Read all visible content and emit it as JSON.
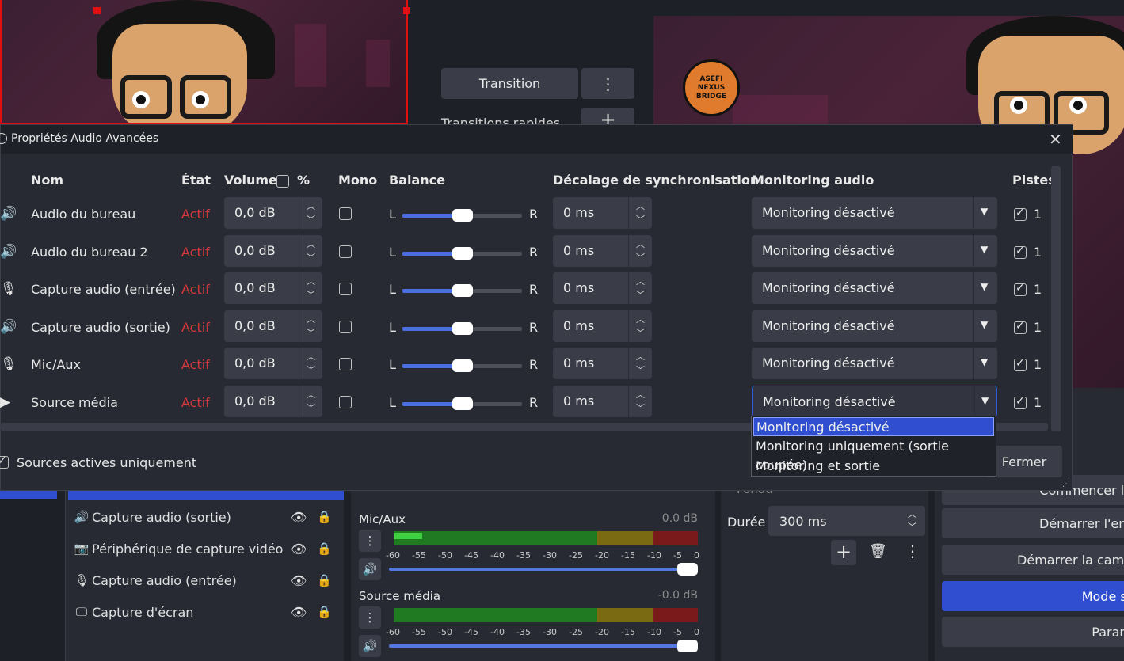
{
  "background": {
    "transition_button": "Transition",
    "quick_transitions_label": "Transitions rapides",
    "logo_text": "ASEFI NEXUS BRIDGE",
    "sources": [
      {
        "icon": "speaker-icon",
        "glyph": "🔊",
        "label": "Capture audio (sortie)"
      },
      {
        "icon": "camera-icon",
        "glyph": "📷",
        "label": "Périphérique de capture vidéo"
      },
      {
        "icon": "microphone-icon",
        "glyph": "🎙",
        "label": "Capture audio (entrée)"
      },
      {
        "icon": "monitor-icon",
        "glyph": "🖵",
        "label": "Capture d'écran"
      }
    ],
    "mixer": [
      {
        "name": "Mic/Aux",
        "db": "0.0 dB"
      },
      {
        "name": "Source média",
        "db": "-0.0 dB"
      }
    ],
    "meter_scale": [
      "-60",
      "-55",
      "-50",
      "-45",
      "-40",
      "-35",
      "-30",
      "-25",
      "-20",
      "-15",
      "-10",
      "-5",
      "0"
    ],
    "transition_panel": {
      "fade_label": "Fondu",
      "duration_label": "Durée",
      "duration_value": "300 ms"
    },
    "controls": [
      {
        "label": "Commencer le",
        "style": "dark"
      },
      {
        "label": "Démarrer l'enr",
        "style": "dark"
      },
      {
        "label": "Démarrer la camé",
        "style": "dark"
      },
      {
        "label": "Mode st",
        "style": "blue"
      },
      {
        "label": "Param",
        "style": "dark"
      }
    ]
  },
  "dialog": {
    "title": "Propriétés Audio Avancées",
    "headers": {
      "name": "Nom",
      "state": "État",
      "volume": "Volume",
      "percent": "%",
      "mono": "Mono",
      "balance": "Balance",
      "sync_offset": "Décalage de synchronisation",
      "monitoring": "Monitoring audio",
      "tracks": "Pistes"
    },
    "balance_L": "L",
    "balance_R": "R",
    "rows": [
      {
        "icon": "speaker-icon",
        "glyph": "🔊",
        "name": "Audio du bureau",
        "state": "Actif",
        "volume": "0,0 dB",
        "mono": false,
        "balance": 0.5,
        "sync": "0 ms",
        "monitoring": "Monitoring désactivé",
        "track": "1",
        "track_checked": true
      },
      {
        "icon": "speaker-icon",
        "glyph": "🔊",
        "name": "Audio du bureau 2",
        "state": "Actif",
        "volume": "0,0 dB",
        "mono": false,
        "balance": 0.5,
        "sync": "0 ms",
        "monitoring": "Monitoring désactivé",
        "track": "1",
        "track_checked": true
      },
      {
        "icon": "microphone-icon",
        "glyph": "🎙",
        "name": "Capture audio (entrée)",
        "state": "Actif",
        "volume": "0,0 dB",
        "mono": false,
        "balance": 0.5,
        "sync": "0 ms",
        "monitoring": "Monitoring désactivé",
        "track": "1",
        "track_checked": true
      },
      {
        "icon": "speaker-icon",
        "glyph": "🔊",
        "name": "Capture audio (sortie)",
        "state": "Actif",
        "volume": "0,0 dB",
        "mono": false,
        "balance": 0.5,
        "sync": "0 ms",
        "monitoring": "Monitoring désactivé",
        "track": "1",
        "track_checked": true
      },
      {
        "icon": "microphone-icon",
        "glyph": "🎙",
        "name": "Mic/Aux",
        "state": "Actif",
        "volume": "0,0 dB",
        "mono": false,
        "balance": 0.5,
        "sync": "0 ms",
        "monitoring": "Monitoring désactivé",
        "track": "1",
        "track_checked": true
      },
      {
        "icon": "play-icon",
        "glyph": "▶",
        "name": "Source média",
        "state": "Actif",
        "volume": "0,0 dB",
        "mono": false,
        "balance": 0.5,
        "sync": "0 ms",
        "monitoring": "Monitoring désactivé",
        "track": "1",
        "track_checked": true
      }
    ],
    "monitoring_options": [
      "Monitoring désactivé",
      "Monitoring uniquement (sortie coupée)",
      "Monitoring et sortie"
    ],
    "selected_option_index": 0,
    "active_only_label": "Sources actives uniquement",
    "active_only_checked": true,
    "close_button": "Fermer"
  }
}
